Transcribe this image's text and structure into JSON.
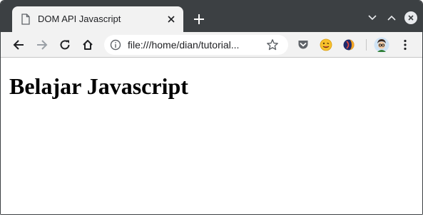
{
  "tab": {
    "title": "DOM API Javascript"
  },
  "omnibox": {
    "url": "file:///home/dian/tutorial..."
  },
  "page": {
    "heading": "Belajar Javascript"
  },
  "colors": {
    "frame": "#3c4043",
    "toolbar": "#f2f2f2",
    "tab_active": "#f2f2f2",
    "pocket": "#ef4056",
    "emoji": "#f7c02c"
  },
  "icons": {
    "favicon": "page-icon",
    "tab_close": "close-icon",
    "new_tab": "plus-icon",
    "back": "back-arrow-icon",
    "forward": "forward-arrow-icon",
    "reload": "reload-icon",
    "home": "home-icon",
    "info": "info-icon",
    "star": "star-icon",
    "ext_pocket": "pocket-icon",
    "ext_emoji": "emoji-icon",
    "ext_third": "extension-icon",
    "profile": "avatar-icon",
    "menu": "kebab-menu-icon",
    "minimize": "chevron-down-icon",
    "maximize": "chevron-up-icon",
    "window_close": "close-icon"
  }
}
